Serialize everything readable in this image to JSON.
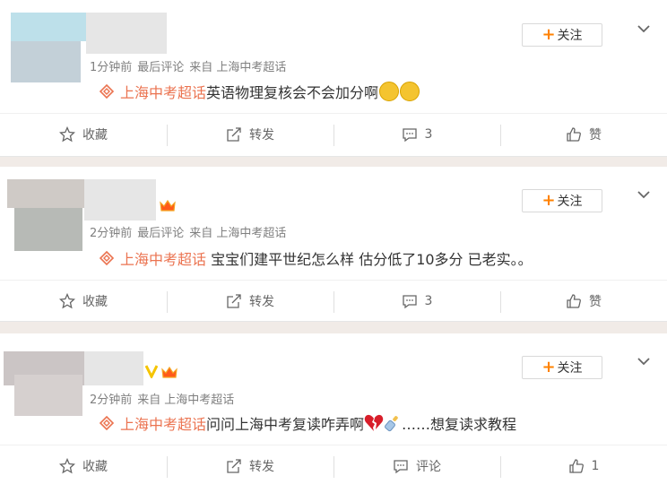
{
  "colors": {
    "accent": "#ff8200",
    "topic": "#eb7350",
    "meta": "#808080"
  },
  "posts": [
    {
      "meta": {
        "time": "1分钟前",
        "last_comment": "最后评论",
        "source_prefix": "来自",
        "source": "上海中考超话"
      },
      "follow_label": "关注",
      "topic": "上海中考超话",
      "text": "英语物理复核会不会加分啊",
      "emojis": [
        "crying-face-icon",
        "crying-face-icon"
      ],
      "actions": {
        "favorite": "收藏",
        "repost": "转发",
        "comment": "3",
        "like": "赞"
      }
    },
    {
      "meta": {
        "time": "2分钟前",
        "last_comment": "最后评论",
        "source_prefix": "来自",
        "source": "上海中考超话"
      },
      "follow_label": "关注",
      "topic": "上海中考超话",
      "text": " 宝宝们建平世纪怎么样 估分低了10多分 已老实。。",
      "emojis": [],
      "actions": {
        "favorite": "收藏",
        "repost": "转发",
        "comment": "3",
        "like": "赞"
      }
    },
    {
      "meta": {
        "time": "2分钟前",
        "last_comment": "",
        "source_prefix": "来自",
        "source": "上海中考超话"
      },
      "follow_label": "关注",
      "topic": "上海中考超话",
      "text_before": "问问上海中考复读咋弄啊",
      "text_after": "……想复读求教程",
      "emojis": [
        "broken-heart-icon",
        "baby-bottle-icon"
      ],
      "actions": {
        "favorite": "收藏",
        "repost": "转发",
        "comment": "评论",
        "like": "1"
      }
    }
  ]
}
